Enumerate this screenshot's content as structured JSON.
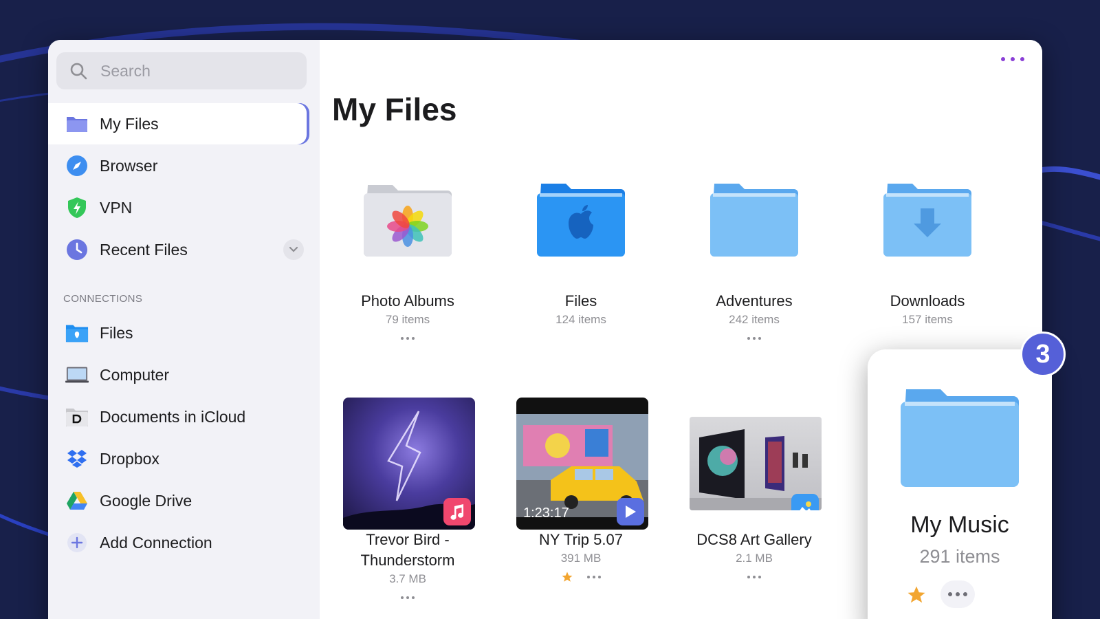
{
  "search": {
    "placeholder": "Search"
  },
  "sidebar": {
    "items": [
      {
        "label": "My Files",
        "icon": "folder-icon",
        "active": true
      },
      {
        "label": "Browser",
        "icon": "compass-icon"
      },
      {
        "label": "VPN",
        "icon": "shield-icon"
      },
      {
        "label": "Recent Files",
        "icon": "clock-icon",
        "expandable": true
      }
    ],
    "connections_header": "CONNECTIONS",
    "connections": [
      {
        "label": "Files",
        "icon": "files-app-icon"
      },
      {
        "label": "Computer",
        "icon": "computer-icon"
      },
      {
        "label": "Documents in iCloud",
        "icon": "documents-icon"
      },
      {
        "label": "Dropbox",
        "icon": "dropbox-icon"
      },
      {
        "label": "Google Drive",
        "icon": "google-drive-icon"
      },
      {
        "label": "Add Connection",
        "icon": "plus-icon"
      }
    ]
  },
  "main": {
    "title": "My Files",
    "folders": [
      {
        "name": "Photo Albums",
        "meta": "79 items"
      },
      {
        "name": "Files",
        "meta": "124 items"
      },
      {
        "name": "Adventures",
        "meta": "242 items"
      },
      {
        "name": "Downloads",
        "meta": "157 items"
      }
    ],
    "files": [
      {
        "name_line1": "Trevor Bird -",
        "name_line2": "Thunderstorm",
        "meta": "3.7 MB",
        "type": "audio"
      },
      {
        "name": "NY Trip 5.07",
        "meta": "391 MB",
        "duration": "1:23:17",
        "type": "video",
        "starred": true
      },
      {
        "name": "DCS8 Art Gallery",
        "meta": "2.1 MB",
        "type": "image"
      }
    ]
  },
  "drag_card": {
    "name": "My Music",
    "meta": "291 items",
    "count": "3",
    "starred": true
  },
  "colors": {
    "accent": "#6b76e0",
    "folder_blue": "#6fb7f3",
    "purple_more": "#8a3fd6",
    "star": "#f2a530",
    "badge": "#5560d8"
  }
}
